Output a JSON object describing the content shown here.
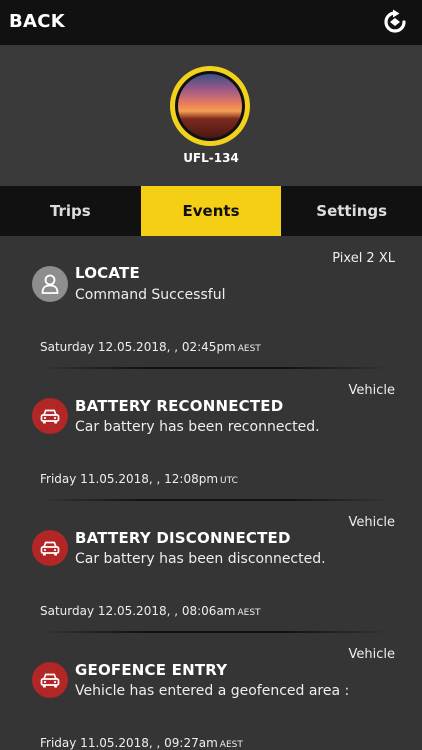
{
  "header": {
    "back_label": "BACK",
    "refresh_icon": "refresh-icon"
  },
  "profile": {
    "vehicle_id": "UFL-134"
  },
  "tabs": [
    {
      "label": "Trips",
      "active": false
    },
    {
      "label": "Events",
      "active": true
    },
    {
      "label": "Settings",
      "active": false
    }
  ],
  "colors": {
    "accent": "#f5cf16",
    "alert_red": "#b32626",
    "neutral_icon": "#8e8e8e",
    "background": "#353535",
    "bar": "#111111"
  },
  "events": [
    {
      "source": "Pixel 2 XL",
      "icon": "person-icon",
      "title": "LOCATE",
      "description": "Command Successful",
      "date": "Saturday 12.05.2018, , 02:45pm",
      "tz": "AEST"
    },
    {
      "source": "Vehicle",
      "icon": "car-icon",
      "title": "BATTERY RECONNECTED",
      "description": "Car battery has been reconnected.",
      "date": "Friday 11.05.2018, , 12:08pm",
      "tz": "UTC"
    },
    {
      "source": "Vehicle",
      "icon": "car-icon",
      "title": "BATTERY DISCONNECTED",
      "description": "Car battery has been disconnected.",
      "date": "Saturday 12.05.2018, , 08:06am",
      "tz": "AEST"
    },
    {
      "source": "Vehicle",
      "icon": "car-icon",
      "title": "GEOFENCE ENTRY",
      "description": "Vehicle has entered a geofenced area :",
      "date": "Friday 11.05.2018, , 09:27am",
      "tz": "AEST"
    }
  ]
}
